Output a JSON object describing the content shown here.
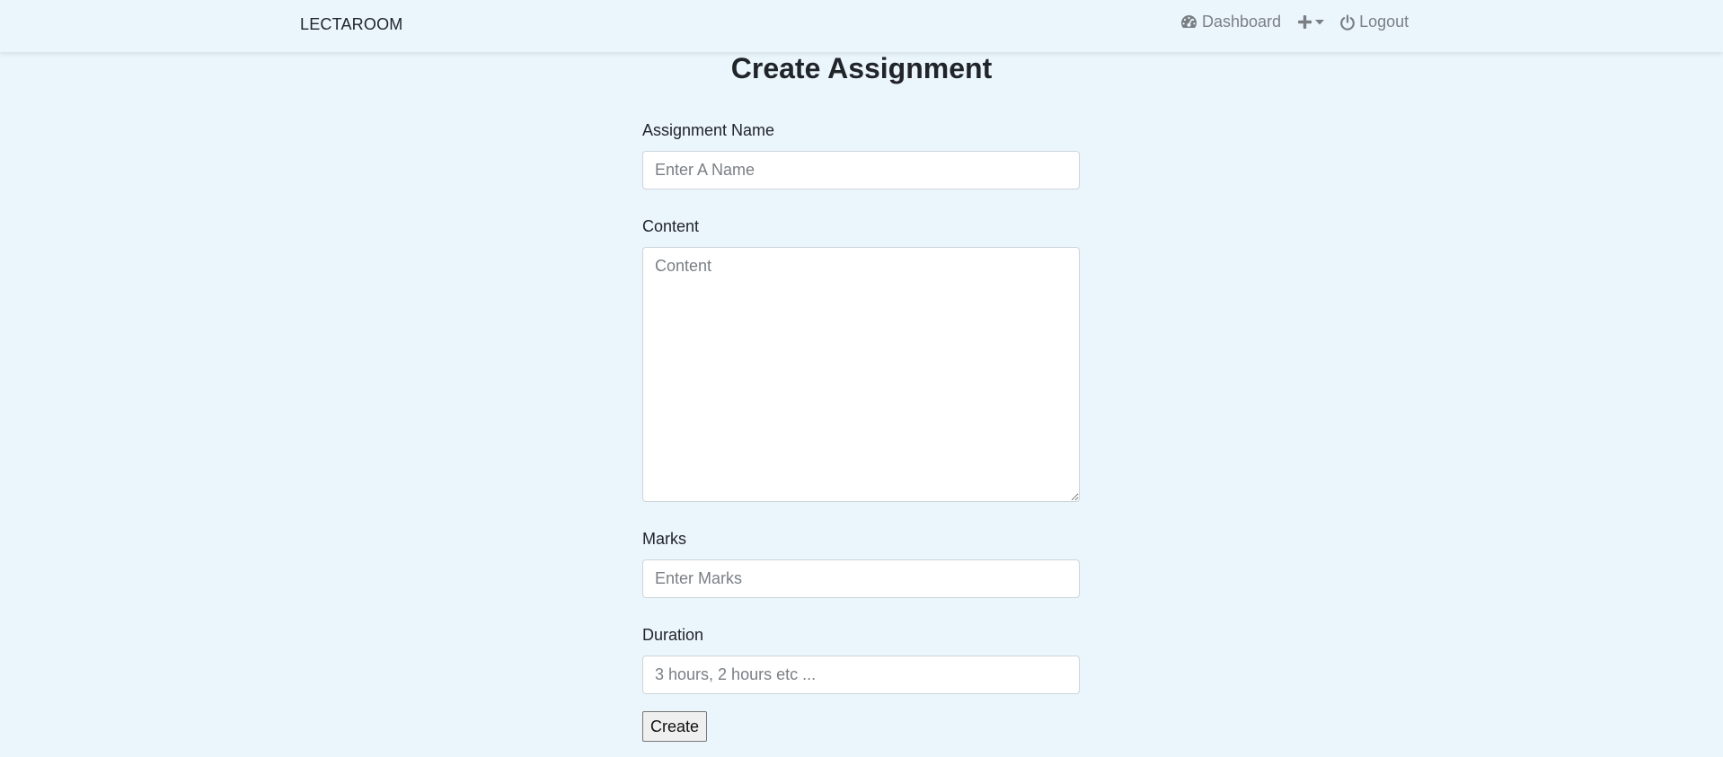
{
  "navbar": {
    "brand": "LECTAROOM",
    "dashboard_icon": "tachometer-icon",
    "dashboard_label": "Dashboard",
    "add_icon": "plus-icon",
    "dropdown_icon": "caret-down-icon",
    "logout_icon": "power-icon",
    "logout_label": "Logout"
  },
  "page": {
    "title": "Create Assignment"
  },
  "form": {
    "name_label": "Assignment Name",
    "name_placeholder": "Enter A Name",
    "content_label": "Content",
    "content_placeholder": "Content",
    "marks_label": "Marks",
    "marks_placeholder": "Enter Marks",
    "duration_label": "Duration",
    "duration_placeholder": "3 hours, 2 hours etc ...",
    "submit_label": "Create"
  },
  "colors": {
    "background": "#ebf6fc",
    "nav_text": "#7a7f84",
    "heading": "#212529"
  }
}
